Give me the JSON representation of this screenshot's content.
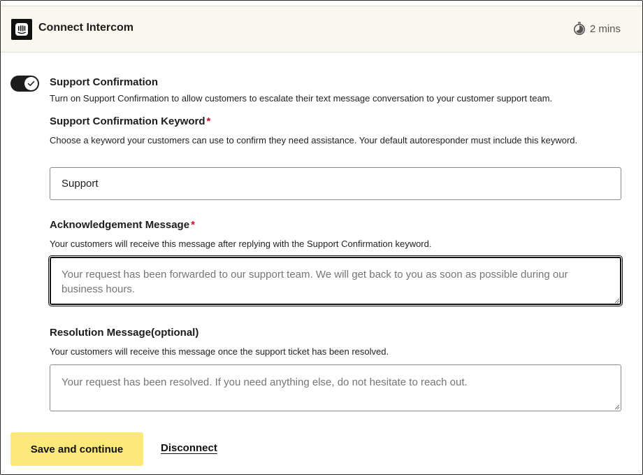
{
  "header": {
    "title": "Connect Intercom",
    "duration": "2 mins",
    "logo_icon": "intercom-logo",
    "timer_icon": "stopwatch-icon"
  },
  "support_confirmation": {
    "toggle_on": true,
    "label": "Support Confirmation",
    "description": "Turn on Support Confirmation to allow customers to escalate their text message conversation to your customer support team."
  },
  "keyword": {
    "label": "Support Confirmation Keyword",
    "required_mark": "*",
    "description": "Choose a keyword your customers can use to confirm they need assistance. Your default autoresponder must include this keyword.",
    "value": "Support"
  },
  "acknowledgement": {
    "label": "Acknowledgement Message",
    "required_mark": "*",
    "description": "Your customers will receive this message after replying with the Support Confirmation keyword.",
    "placeholder": "Your request has been forwarded to our support team. We will get back to you as soon as possible during our business hours."
  },
  "resolution": {
    "label": "Resolution Message(optional)",
    "description": "Your customers will receive this message once the support ticket has been resolved.",
    "placeholder": "Your request has been resolved. If you need anything else, do not hesitate to reach out."
  },
  "actions": {
    "save_label": "Save and continue",
    "disconnect_label": "Disconnect"
  },
  "colors": {
    "header_bg": "#faf7f0",
    "primary_button": "#fde97a",
    "required": "#c4132a",
    "toggle_on": "#1d1d1d"
  }
}
